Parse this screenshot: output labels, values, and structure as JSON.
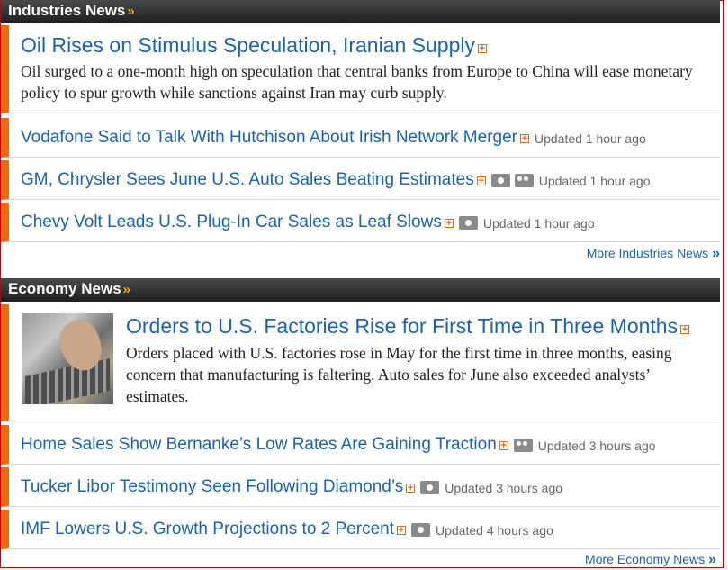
{
  "industries": {
    "header": "Industries News",
    "header_chevron": "»",
    "lead": {
      "headline": "Oil Rises on Stimulus Speculation, Iranian Supply",
      "summary": "Oil surged to a one-month high on speculation that central banks from Europe to China will ease monetary policy to spur growth while sanctions against Iran may curb supply."
    },
    "items": [
      {
        "headline": "Vodafone Said to Talk With Hutchison About Irish Network Merger",
        "updated": "Updated 1 hour ago"
      },
      {
        "headline": "GM, Chrysler Sees June U.S. Auto Sales Beating Estimates",
        "updated": "Updated 1 hour ago"
      },
      {
        "headline": "Chevy Volt Leads U.S. Plug-In Car Sales as Leaf Slows",
        "updated": "Updated 1 hour ago"
      }
    ],
    "more": "More Industries News",
    "more_arrow": "»"
  },
  "economy": {
    "header": "Economy News",
    "header_chevron": "»",
    "lead": {
      "headline": "Orders to U.S. Factories Rise for First Time in Three Months",
      "summary": "Orders placed with U.S. factories rose in May for the first time in three months, easing concern that manufacturing is faltering. Auto sales for June also exceeded analysts’ estimates."
    },
    "items": [
      {
        "headline": "Home Sales Show Bernanke’s Low Rates Are Gaining Traction",
        "updated": "Updated 3 hours ago"
      },
      {
        "headline": "Tucker Libor Testimony Seen Following Diamond’s",
        "updated": "Updated 3 hours ago"
      },
      {
        "headline": "IMF Lowers U.S. Growth Projections to 2 Percent",
        "updated": "Updated 4 hours ago"
      }
    ],
    "more": "More Economy News",
    "more_arrow": "»"
  },
  "plus_glyph": "+",
  "icons": [
    "expand-plus-icon",
    "camera-icon",
    "video-icon"
  ],
  "colors": {
    "accent": "#f26a10",
    "link": "#1a62b4",
    "header_bg": "#2a2a2a",
    "chevron": "#f2a900"
  }
}
